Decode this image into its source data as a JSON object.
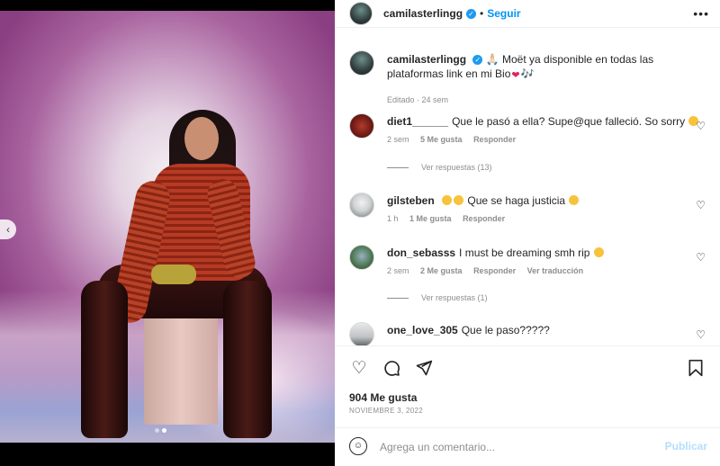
{
  "post": {
    "author": "camilasterlingg",
    "follow_label": "Seguir",
    "separator": "•",
    "more_label": "•••"
  },
  "caption": {
    "username": "camilasterlingg",
    "text_before": "Moët ya disponible en todas las plataformas link en mi Bio",
    "meta": "Editado · 24 sem"
  },
  "comments": [
    {
      "username": "diet1______",
      "text": "Que le pasó a ella? Supe@que falleció. So sorry",
      "time": "2 sem",
      "likes": "5 Me gusta",
      "reply_label": "Responder",
      "translate_label": "",
      "replies_label": "Ver respuestas (13)"
    },
    {
      "username": "gilsteben",
      "text": "Que se haga justicia",
      "time": "1 h",
      "likes": "1 Me gusta",
      "reply_label": "Responder",
      "translate_label": "",
      "replies_label": ""
    },
    {
      "username": "don_sebasss",
      "text": "I must be dreaming smh rip",
      "time": "2 sem",
      "likes": "2 Me gusta",
      "reply_label": "Responder",
      "translate_label": "Ver traducción",
      "replies_label": "Ver respuestas (1)"
    },
    {
      "username": "one_love_305",
      "text": "Que le paso?????",
      "time": "",
      "likes": "",
      "reply_label": "",
      "translate_label": "",
      "replies_label": ""
    }
  ],
  "actions": {
    "like_icon": "heart-icon",
    "comment_icon": "comment-icon",
    "share_icon": "share-icon",
    "save_icon": "bookmark-icon"
  },
  "stats": {
    "likes": "904 Me gusta",
    "date": "NOVIEMBRE 3, 2022"
  },
  "composer": {
    "placeholder": "Agrega un comentario...",
    "post_label": "Publicar"
  },
  "carousel": {
    "current_index": 2,
    "total": 2
  },
  "colors": {
    "accent": "#0095f6",
    "post_disabled": "#b2dffc",
    "muted": "#8e8e8e",
    "verified": "#1d9bf0"
  }
}
